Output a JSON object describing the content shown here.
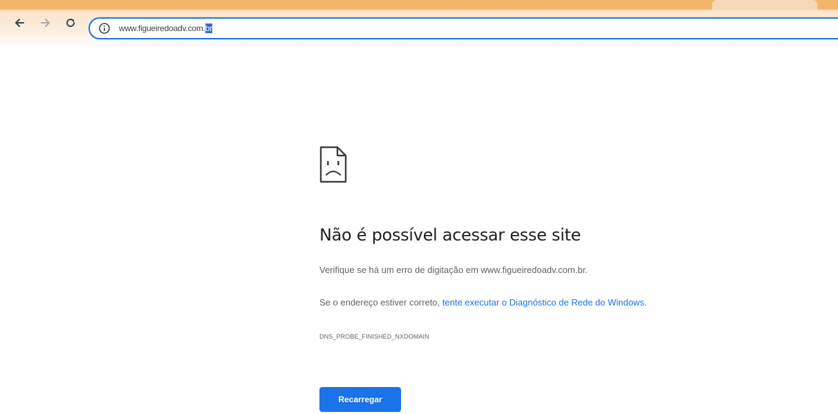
{
  "browser": {
    "url_main": "www.figueiredoadv.com.",
    "url_selected": "br",
    "icons": [
      "back-arrow-icon",
      "forward-arrow-icon",
      "reload-icon",
      "info-icon"
    ]
  },
  "error": {
    "icon": "sad-document-icon",
    "title": "Não é possível acessar esse site",
    "line1": "Verifique se há um erro de digitação em www.figueiredoadv.com.br.",
    "line2_prefix": "Se o endereço estiver correto, ",
    "line2_link": "tente executar o Diagnóstico de Rede do Windows",
    "line2_suffix": ".",
    "code": "DNS_PROBE_FINISHED_NXDOMAIN",
    "reload_label": "Recarregar"
  },
  "colors": {
    "accent": "#1a73e8",
    "tab_strip": "#f3b56c",
    "title_text": "#202124",
    "body_text": "#5f6368"
  }
}
